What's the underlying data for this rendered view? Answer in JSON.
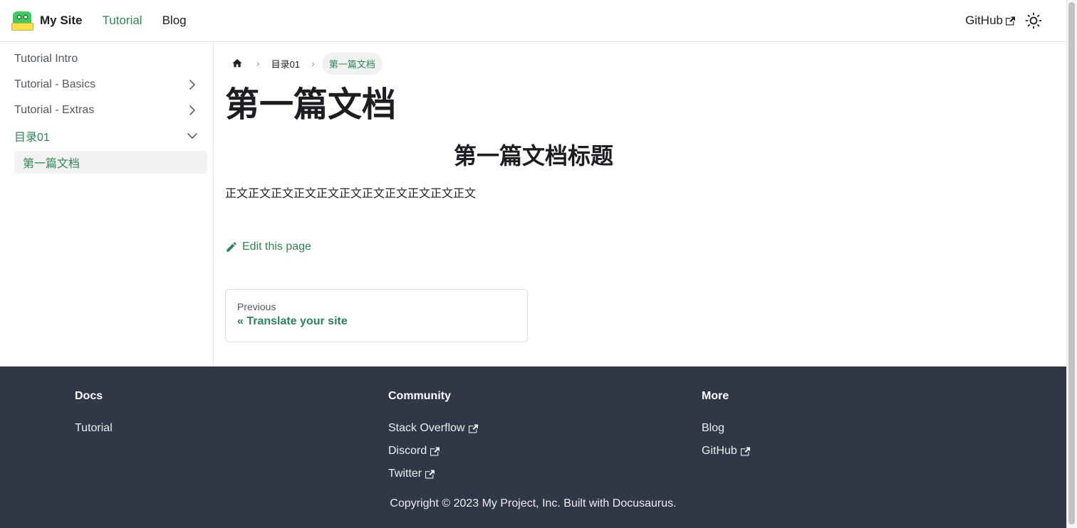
{
  "navbar": {
    "brand": "My Site",
    "links": [
      "Tutorial",
      "Blog"
    ],
    "github": "GitHub"
  },
  "sidebar": {
    "items": [
      {
        "label": "Tutorial Intro"
      },
      {
        "label": "Tutorial - Basics"
      },
      {
        "label": "Tutorial - Extras"
      },
      {
        "label": "目录01"
      }
    ],
    "sub_item": "第一篇文档"
  },
  "breadcrumbs": {
    "parent": "目录01",
    "current": "第一篇文档"
  },
  "doc": {
    "title": "第一篇文档",
    "heading": "第一篇文档标题",
    "body": "正文正文正文正文正文正文正文正文正文正文正文",
    "edit_link": "Edit this page"
  },
  "pager": {
    "sublabel": "Previous",
    "label": "« Translate your site"
  },
  "footer": {
    "columns": [
      {
        "title": "Docs",
        "links": [
          "Tutorial"
        ]
      },
      {
        "title": "Community",
        "links": [
          "Stack Overflow",
          "Discord",
          "Twitter"
        ]
      },
      {
        "title": "More",
        "links": [
          "Blog",
          "GitHub"
        ]
      }
    ],
    "copyright": "Copyright © 2023 My Project, Inc. Built with Docusaurus."
  },
  "colors": {
    "accent": "#2e8555",
    "footer_bg": "#303846"
  }
}
